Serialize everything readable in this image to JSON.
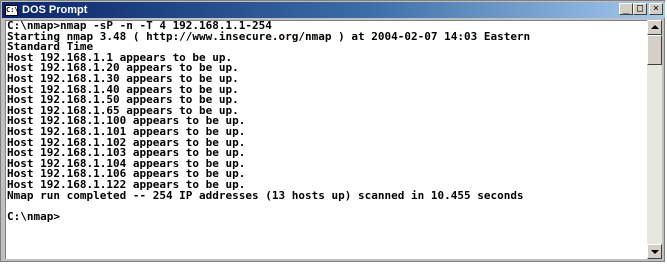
{
  "window": {
    "title": "DOS Prompt",
    "icon": "cmd-icon",
    "icon_glyph": "C:\\",
    "buttons": {
      "minimize": "_",
      "maximize": "□",
      "close": "×"
    }
  },
  "console": {
    "lines": [
      "C:\\nmap>nmap -sP -n -T 4 192.168.1.1-254",
      "Starting nmap 3.48 ( http://www.insecure.org/nmap ) at 2004-02-07 14:03 Eastern",
      "Standard Time",
      "Host 192.168.1.1 appears to be up.",
      "Host 192.168.1.20 appears to be up.",
      "Host 192.168.1.30 appears to be up.",
      "Host 192.168.1.40 appears to be up.",
      "Host 192.168.1.50 appears to be up.",
      "Host 192.168.1.65 appears to be up.",
      "Host 192.168.1.100 appears to be up.",
      "Host 192.168.1.101 appears to be up.",
      "Host 192.168.1.102 appears to be up.",
      "Host 192.168.1.103 appears to be up.",
      "Host 192.168.1.104 appears to be up.",
      "Host 192.168.1.106 appears to be up.",
      "Host 192.168.1.122 appears to be up.",
      "Nmap run completed -- 254 IP addresses (13 hosts up) scanned in 10.455 seconds",
      "",
      "C:\\nmap>"
    ]
  }
}
